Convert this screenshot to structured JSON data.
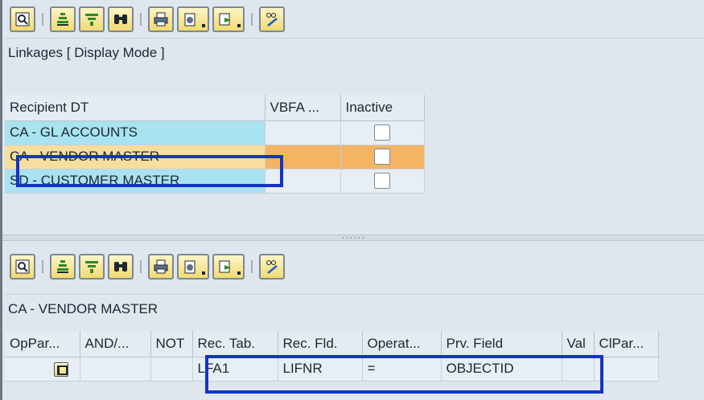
{
  "top_toolbar": {
    "icons": [
      "details-icon",
      "sort-ascending-icon",
      "filter-icon",
      "find-icon",
      "print-icon",
      "export-icon",
      "layout-icon",
      "edit-icon"
    ]
  },
  "top_title": "Linkages [ Display Mode ]",
  "top_table": {
    "headers": [
      "Recipient DT",
      "VBFA ...",
      "Inactive"
    ],
    "rows": [
      {
        "recipient": "CA - GL ACCOUNTS",
        "vbfa": "",
        "inactive": false
      },
      {
        "recipient": "CA - VENDOR MASTER",
        "vbfa": "",
        "inactive": false
      },
      {
        "recipient": "SD - CUSTOMER MASTER",
        "vbfa": "",
        "inactive": false
      }
    ]
  },
  "bottom_title": "CA - VENDOR MASTER",
  "bottom_table": {
    "headers": [
      "OpPar...",
      "AND/...",
      "NOT",
      "Rec. Tab.",
      "Rec. Fld.",
      "Operat...",
      "Prv. Field",
      "Val",
      "ClPar..."
    ],
    "rows": [
      {
        "oppar": "",
        "and": "",
        "not": "",
        "rec_tab": "LFA1",
        "rec_fld": "LIFNR",
        "operator": "=",
        "prv_field": "OBJECTID",
        "val": "",
        "clpar": ""
      }
    ]
  },
  "colors": {
    "highlight_box": "#1433c8",
    "selected_row": "#f4b463",
    "key_cell": "#a9e2f0",
    "selected_key": "#f7dd9e"
  }
}
